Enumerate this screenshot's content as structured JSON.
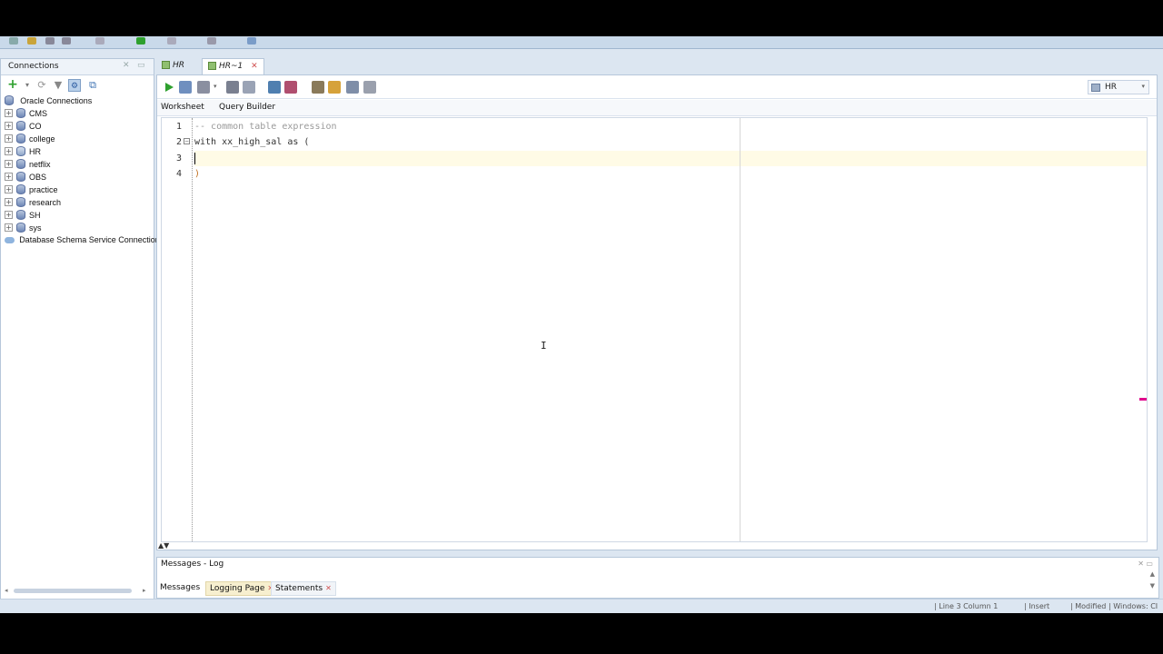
{
  "app": {
    "connections_panel": {
      "title": "Connections",
      "root_label": "Oracle Connections",
      "items": [
        {
          "label": "CMS"
        },
        {
          "label": "CO"
        },
        {
          "label": "college"
        },
        {
          "label": "HR"
        },
        {
          "label": "netflix"
        },
        {
          "label": "OBS"
        },
        {
          "label": "practice"
        },
        {
          "label": "research"
        },
        {
          "label": "SH"
        },
        {
          "label": "sys"
        }
      ],
      "cloud_label": "Database Schema Service Connection"
    },
    "editor_tabs": [
      {
        "label": "HR"
      },
      {
        "label": "HR~1"
      }
    ],
    "editor": {
      "subtabs": [
        "Worksheet",
        "Query Builder"
      ],
      "connection_selector": "HR",
      "lines": [
        {
          "num": "1",
          "text": "-- common table expression"
        },
        {
          "num": "2",
          "text": "with xx_high_sal as ("
        },
        {
          "num": "3",
          "text": ""
        },
        {
          "num": "4",
          "text": ")"
        }
      ]
    },
    "log": {
      "title": "Messages - Log",
      "tabs": [
        "Messages",
        "Logging Page",
        "Statements"
      ]
    },
    "status_bar": {
      "position": "Line 3 Column 1",
      "mode": "Insert",
      "modified": "Modified",
      "line_ending": "Windows: CI"
    },
    "colors": {
      "accent_green": "#2ea02e",
      "marker_magenta": "#e0008c",
      "panel_bg": "#dce6f1"
    }
  }
}
